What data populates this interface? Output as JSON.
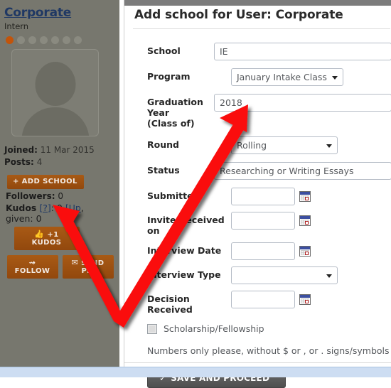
{
  "sidebar": {
    "username": "Corporate",
    "rank": "Intern",
    "rank_dots_total": 7,
    "rank_dots_filled": 1,
    "avatar_alt": "default-avatar",
    "joined_label": "Joined:",
    "joined_value": "11 Mar 2015",
    "posts_label": "Posts:",
    "posts_value": "4",
    "add_school_button": "+ ADD SCHOOL",
    "followers_label": "Followers:",
    "followers_value": "0",
    "kudos_label": "Kudos",
    "kudos_help": "[?]",
    "kudos_value": "0",
    "kudos_given_bracket": "[Up",
    "kudos_given_label": ", given:",
    "kudos_given_value": "0",
    "kudos_button": "+1 KUDOS",
    "follow_button": "FOLLOW",
    "send_pm_button": "SEND PM",
    "accent_color": "#c2540a",
    "button_color": "#a85a15",
    "background_color": "#77776e",
    "username_color": "#1f3864"
  },
  "modal": {
    "title": "Add school for User: Corporate",
    "fields": [
      {
        "label": "School",
        "type": "text",
        "value": "IE"
      },
      {
        "label": "Program",
        "type": "select",
        "value": "January Intake Class"
      },
      {
        "label": "Graduation Year (Class of)",
        "label_line1": "Graduation Year",
        "label_line2": "(Class of)",
        "type": "text",
        "value": "2018"
      },
      {
        "label": "Round",
        "type": "select",
        "value": "Rolling"
      },
      {
        "label": "Status",
        "type": "text",
        "value": "Researching or Writing Essays"
      },
      {
        "label": "Submitted",
        "type": "date",
        "value": ""
      },
      {
        "label": "Invite Received on",
        "type": "date",
        "value": ""
      },
      {
        "label": "Interview Date",
        "type": "date",
        "value": ""
      },
      {
        "label": "Interview Type",
        "type": "select",
        "value": ""
      },
      {
        "label": "Decision Received",
        "type": "date",
        "value": ""
      }
    ],
    "checkbox_label": "Scholarship/Fellowship",
    "checkbox_checked": false,
    "note": "Numbers only please, without $ or , or . signs/symbols",
    "save_button": "SAVE AND PROCEED",
    "save_button_check": "✓"
  },
  "annotation": {
    "type": "double-headed-arrow",
    "color": "#fa0a0a",
    "from": "add-school-button",
    "to": "graduation-year-field"
  }
}
